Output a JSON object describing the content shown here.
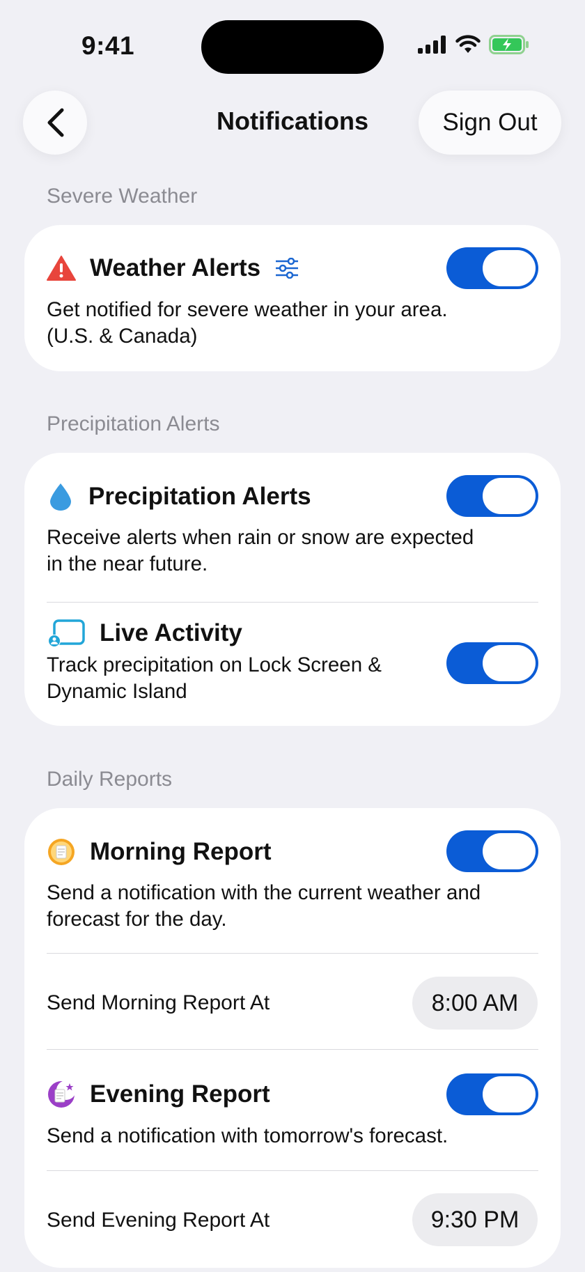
{
  "status_bar": {
    "time": "9:41"
  },
  "header": {
    "title": "Notifications",
    "sign_out_label": "Sign Out"
  },
  "sections": {
    "severe": {
      "label": "Severe Weather",
      "weather_alerts": {
        "title": "Weather Alerts",
        "description_line1": "Get notified for severe weather in your area.",
        "description_line2": "(U.S. & Canada)",
        "enabled": true
      }
    },
    "precipitation": {
      "label": "Precipitation Alerts",
      "precip_alerts": {
        "title": "Precipitation Alerts",
        "description_line1": "Receive alerts when rain or snow are expected",
        "description_line2": "in the near future.",
        "enabled": true
      },
      "live_activity": {
        "title": "Live Activity",
        "description_line1": "Track precipitation on Lock Screen &",
        "description_line2": "Dynamic Island",
        "enabled": true
      }
    },
    "daily": {
      "label": "Daily Reports",
      "morning": {
        "title": "Morning Report",
        "description_line1": "Send a notification with the current weather and",
        "description_line2": "forecast for the day.",
        "enabled": true,
        "time_label": "Send Morning Report At",
        "time_value": "8:00 AM"
      },
      "evening": {
        "title": "Evening Report",
        "description": "Send a notification with tomorrow's forecast.",
        "enabled": true,
        "time_label": "Send Evening Report At",
        "time_value": "9:30 PM"
      }
    }
  },
  "colors": {
    "accent": "#0b5cd6",
    "background": "#f0f0f5",
    "card": "#ffffff",
    "alert_red": "#e8453c",
    "drop_blue": "#3a9be0"
  },
  "icons": [
    "back-chevron-icon",
    "warning-triangle-icon",
    "sliders-icon",
    "raindrop-icon",
    "live-activity-icon",
    "morning-sun-icon",
    "evening-moon-icon"
  ]
}
